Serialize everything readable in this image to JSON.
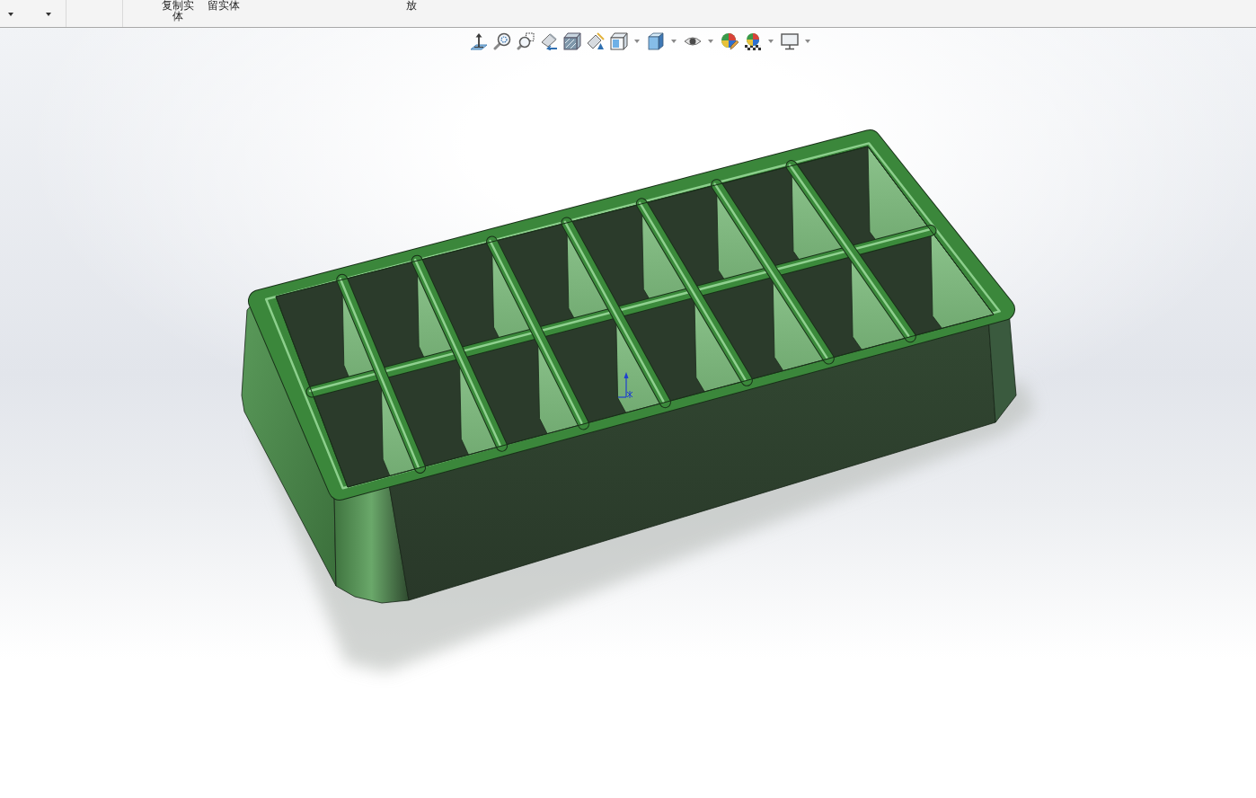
{
  "ribbon": {
    "labels": [
      {
        "lines": [
          "复制实",
          "体"
        ]
      },
      {
        "lines": [
          "留实体"
        ]
      },
      {
        "lines": [
          "放"
        ]
      }
    ]
  },
  "view_toolbar": {
    "buttons": [
      {
        "kind": "orient",
        "dropdown": false
      },
      {
        "kind": "zoomfit",
        "dropdown": false
      },
      {
        "kind": "zoomarea",
        "dropdown": false
      },
      {
        "kind": "previous",
        "dropdown": false
      },
      {
        "kind": "section",
        "dropdown": false
      },
      {
        "kind": "annotation",
        "dropdown": false
      },
      {
        "kind": "orientation",
        "dropdown": true
      },
      {
        "kind": "display",
        "dropdown": true
      },
      {
        "kind": "hide",
        "dropdown": true
      },
      {
        "kind": "appearance",
        "dropdown": false
      },
      {
        "kind": "scene",
        "dropdown": true
      },
      {
        "kind": "settings",
        "dropdown": true
      }
    ]
  }
}
